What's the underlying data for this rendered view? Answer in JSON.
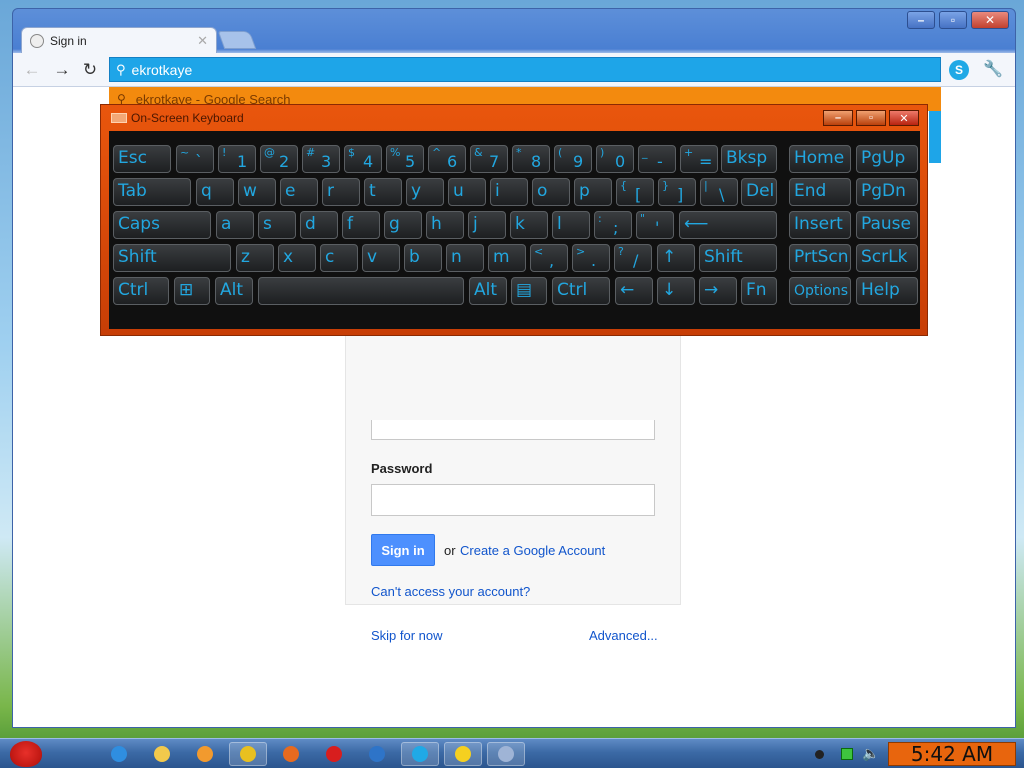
{
  "browser": {
    "tab_title": "Sign in",
    "omnibox_value": "ekrotkaye",
    "suggestion": "ekrotkaye - Google Search"
  },
  "signin": {
    "password_label": "Password",
    "signin_label": "Sign in",
    "or_text": "or",
    "create_account": "Create a Google Account",
    "cant_access": "Can't access your account?",
    "skip": "Skip for now",
    "advanced": "Advanced..."
  },
  "osk": {
    "title": "On-Screen Keyboard",
    "keys": [
      {
        "id": "esc",
        "label": "Esc"
      },
      {
        "id": "grave",
        "shift": "~",
        "main": "`"
      },
      {
        "id": "1",
        "shift": "!",
        "main": "1"
      },
      {
        "id": "2",
        "shift": "@",
        "main": "2"
      },
      {
        "id": "3",
        "shift": "#",
        "main": "3"
      },
      {
        "id": "4",
        "shift": "$",
        "main": "4"
      },
      {
        "id": "5",
        "shift": "%",
        "main": "5"
      },
      {
        "id": "6",
        "shift": "^",
        "main": "6"
      },
      {
        "id": "7",
        "shift": "&",
        "main": "7"
      },
      {
        "id": "8",
        "shift": "*",
        "main": "8"
      },
      {
        "id": "9",
        "shift": "(",
        "main": "9"
      },
      {
        "id": "0",
        "shift": ")",
        "main": "0"
      },
      {
        "id": "minus",
        "shift": "_",
        "main": "-"
      },
      {
        "id": "equals",
        "shift": "+",
        "main": "="
      },
      {
        "id": "bksp",
        "label": "Bksp"
      },
      {
        "id": "home",
        "label": "Home"
      },
      {
        "id": "pgup",
        "label": "PgUp"
      },
      {
        "id": "tab",
        "label": "Tab"
      },
      {
        "id": "q",
        "label": "q"
      },
      {
        "id": "w",
        "label": "w"
      },
      {
        "id": "e",
        "label": "e"
      },
      {
        "id": "r",
        "label": "r"
      },
      {
        "id": "t",
        "label": "t"
      },
      {
        "id": "y",
        "label": "y"
      },
      {
        "id": "u",
        "label": "u"
      },
      {
        "id": "i",
        "label": "i"
      },
      {
        "id": "o",
        "label": "o"
      },
      {
        "id": "p",
        "label": "p"
      },
      {
        "id": "lbracket",
        "shift": "{",
        "main": "["
      },
      {
        "id": "rbracket",
        "shift": "}",
        "main": "]"
      },
      {
        "id": "backslash",
        "shift": "|",
        "main": "\\"
      },
      {
        "id": "del",
        "label": "Del"
      },
      {
        "id": "end",
        "label": "End"
      },
      {
        "id": "pgdn",
        "label": "PgDn"
      },
      {
        "id": "caps",
        "label": "Caps"
      },
      {
        "id": "a",
        "label": "a"
      },
      {
        "id": "s",
        "label": "s"
      },
      {
        "id": "d",
        "label": "d"
      },
      {
        "id": "f",
        "label": "f"
      },
      {
        "id": "g",
        "label": "g"
      },
      {
        "id": "h",
        "label": "h"
      },
      {
        "id": "j",
        "label": "j"
      },
      {
        "id": "k",
        "label": "k"
      },
      {
        "id": "l",
        "label": "l"
      },
      {
        "id": "semicolon",
        "shift": ":",
        "main": ";"
      },
      {
        "id": "quote",
        "shift": "\"",
        "main": "'"
      },
      {
        "id": "enter",
        "label": "⟵"
      },
      {
        "id": "insert",
        "label": "Insert"
      },
      {
        "id": "pause",
        "label": "Pause"
      },
      {
        "id": "lshift",
        "label": "Shift"
      },
      {
        "id": "z",
        "label": "z"
      },
      {
        "id": "x",
        "label": "x"
      },
      {
        "id": "c",
        "label": "c"
      },
      {
        "id": "v",
        "label": "v"
      },
      {
        "id": "b",
        "label": "b"
      },
      {
        "id": "n",
        "label": "n"
      },
      {
        "id": "m",
        "label": "m"
      },
      {
        "id": "comma",
        "shift": "<",
        "main": ","
      },
      {
        "id": "period",
        "shift": ">",
        "main": "."
      },
      {
        "id": "slash",
        "shift": "?",
        "main": "/"
      },
      {
        "id": "up",
        "label": "↑"
      },
      {
        "id": "rshift",
        "label": "Shift"
      },
      {
        "id": "prtscn",
        "label": "PrtScn"
      },
      {
        "id": "scrlk",
        "label": "ScrLk"
      },
      {
        "id": "lctrl",
        "label": "Ctrl"
      },
      {
        "id": "win",
        "label": "⊞"
      },
      {
        "id": "lalt",
        "label": "Alt"
      },
      {
        "id": "space",
        "label": ""
      },
      {
        "id": "ralt",
        "label": "Alt"
      },
      {
        "id": "menu",
        "label": "▤"
      },
      {
        "id": "rctrl",
        "label": "Ctrl"
      },
      {
        "id": "left",
        "label": "←"
      },
      {
        "id": "down",
        "label": "↓"
      },
      {
        "id": "right",
        "label": "→"
      },
      {
        "id": "fn",
        "label": "Fn"
      },
      {
        "id": "options",
        "label": "Options"
      },
      {
        "id": "help",
        "label": "Help"
      }
    ]
  },
  "taskbar": {
    "clock": "5:42 AM",
    "apps": [
      {
        "name": "internet-explorer",
        "color": "#2f8ee0"
      },
      {
        "name": "windows-explorer",
        "color": "#f2c94c"
      },
      {
        "name": "media-player",
        "color": "#f29a2e"
      },
      {
        "name": "chrome",
        "color": "#e8c020",
        "active": true
      },
      {
        "name": "firefox",
        "color": "#e66a1f"
      },
      {
        "name": "opera",
        "color": "#d81e1e"
      },
      {
        "name": "app-blocks",
        "color": "#2e74c8"
      },
      {
        "name": "skype",
        "color": "#20a9e6",
        "active": true
      },
      {
        "name": "messenger",
        "color": "#f5d020",
        "active": true
      },
      {
        "name": "on-screen-keyboard",
        "color": "#9fb4d6",
        "active": true
      }
    ]
  }
}
